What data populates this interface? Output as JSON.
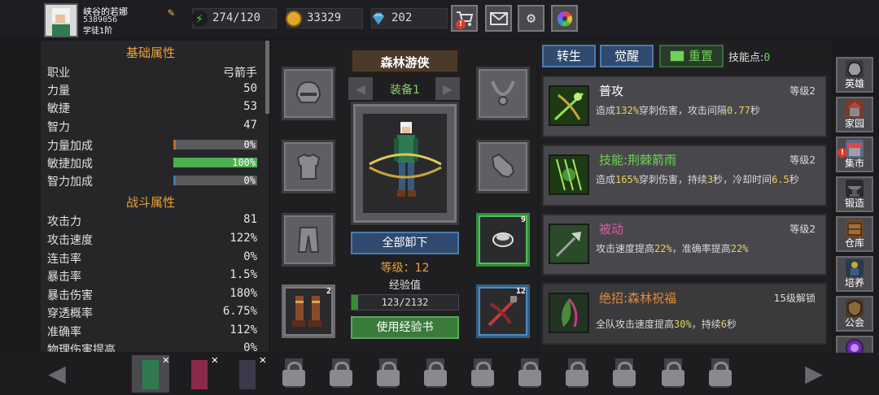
{
  "player": {
    "name": "峡谷的若娜",
    "id": "5389056",
    "rank": "学徒1阶"
  },
  "resources": {
    "energy": "274/120",
    "gold": "33329",
    "gems": "202"
  },
  "top_buttons": [
    "shop-cart-icon",
    "mail-icon",
    "settings-gear-icon",
    "color-wheel-icon"
  ],
  "stats": {
    "basic_title": "基础属性",
    "basic": [
      {
        "label": "职业",
        "value": "弓箭手"
      },
      {
        "label": "力量",
        "value": "50"
      },
      {
        "label": "敏捷",
        "value": "53"
      },
      {
        "label": "智力",
        "value": "47"
      }
    ],
    "bonus": [
      {
        "label": "力量加成",
        "value": "0%",
        "fill": 0.0,
        "color": "#c46a2a"
      },
      {
        "label": "敏捷加成",
        "value": "100%",
        "fill": 1.0,
        "color": "#4caf50"
      },
      {
        "label": "智力加成",
        "value": "0%",
        "fill": 0.0,
        "color": "#3a7ac4"
      }
    ],
    "combat_title": "战斗属性",
    "combat": [
      {
        "label": "攻击力",
        "value": "81"
      },
      {
        "label": "攻击速度",
        "value": "122%"
      },
      {
        "label": "连击率",
        "value": "0%"
      },
      {
        "label": "暴击率",
        "value": "1.5%"
      },
      {
        "label": "暴击伤害",
        "value": "180%"
      },
      {
        "label": "穿透概率",
        "value": "6.75%"
      },
      {
        "label": "准确率",
        "value": "112%"
      },
      {
        "label": "物理伤害提高",
        "value": "0%"
      }
    ]
  },
  "equipment": {
    "class_name": "森林游侠",
    "set_label": "装备1",
    "unequip_label": "全部卸下",
    "level_label": "等级：12",
    "exp_label": "经验值",
    "exp_text": "123/2132",
    "exp_fraction": 0.058,
    "use_exp_label": "使用经验书",
    "slots": {
      "helmet": "helmet-icon",
      "armor": "armor-icon",
      "pants": "pants-icon",
      "boots": "boots-icon",
      "boots_count": "2",
      "necklace": "necklace-icon",
      "gloves": "gloves-icon",
      "ring": "ring-icon",
      "ring_count": "9",
      "weapon": "crossbow-icon",
      "weapon_count": "12"
    }
  },
  "skills": {
    "tab_transfer": "转生",
    "tab_awaken": "觉醒",
    "tab_reset": "重置",
    "points_label": "技能点:",
    "points_value": "0",
    "cards": [
      {
        "name": "普攻",
        "name_color": "#ffffff",
        "level": "等级2",
        "desc_pre": "造成",
        "num1": "132%",
        "desc_mid": "穿刺伤害，攻击间隔",
        "num2": "0.77",
        "desc_post": "秒"
      },
      {
        "name": "技能:荆棘箭雨",
        "name_color": "#6fd15a",
        "level": "等级2",
        "desc_pre": "造成",
        "num1": "165%",
        "desc_mid": "穿刺伤害，持续",
        "num2": "3",
        "desc_post": "秒，冷却时间",
        "num3": "6.5",
        "desc_end": "秒"
      },
      {
        "name": "被动",
        "name_color": "#e05aa0",
        "level": "等级2",
        "desc_pre": "攻击速度提高",
        "num1": "22%",
        "desc_mid": "，准确率提高",
        "num2": "22%",
        "desc_post": ""
      },
      {
        "name": "绝招:森林祝福",
        "name_color": "#e08a3a",
        "level": "15级解锁",
        "desc_pre": "全队攻击速度提高",
        "num1": "30%",
        "desc_mid": "，持续",
        "num2": "6",
        "desc_post": "秒"
      }
    ]
  },
  "nav": [
    {
      "label": "英雄",
      "icon": "helmet-icon"
    },
    {
      "label": "家园",
      "icon": "house-icon"
    },
    {
      "label": "集市",
      "icon": "market-icon"
    },
    {
      "label": "锻造",
      "icon": "anvil-icon"
    },
    {
      "label": "仓库",
      "icon": "warehouse-icon"
    },
    {
      "label": "培养",
      "icon": "training-icon"
    },
    {
      "label": "公会",
      "icon": "guild-icon"
    },
    {
      "label": "战斗",
      "icon": "portal-icon"
    }
  ],
  "colors": {
    "accent_orange": "#e8a33a",
    "accent_green": "#6fd15a",
    "button_blue": "#2f4a6e",
    "alert_red": "#d93a2b"
  }
}
